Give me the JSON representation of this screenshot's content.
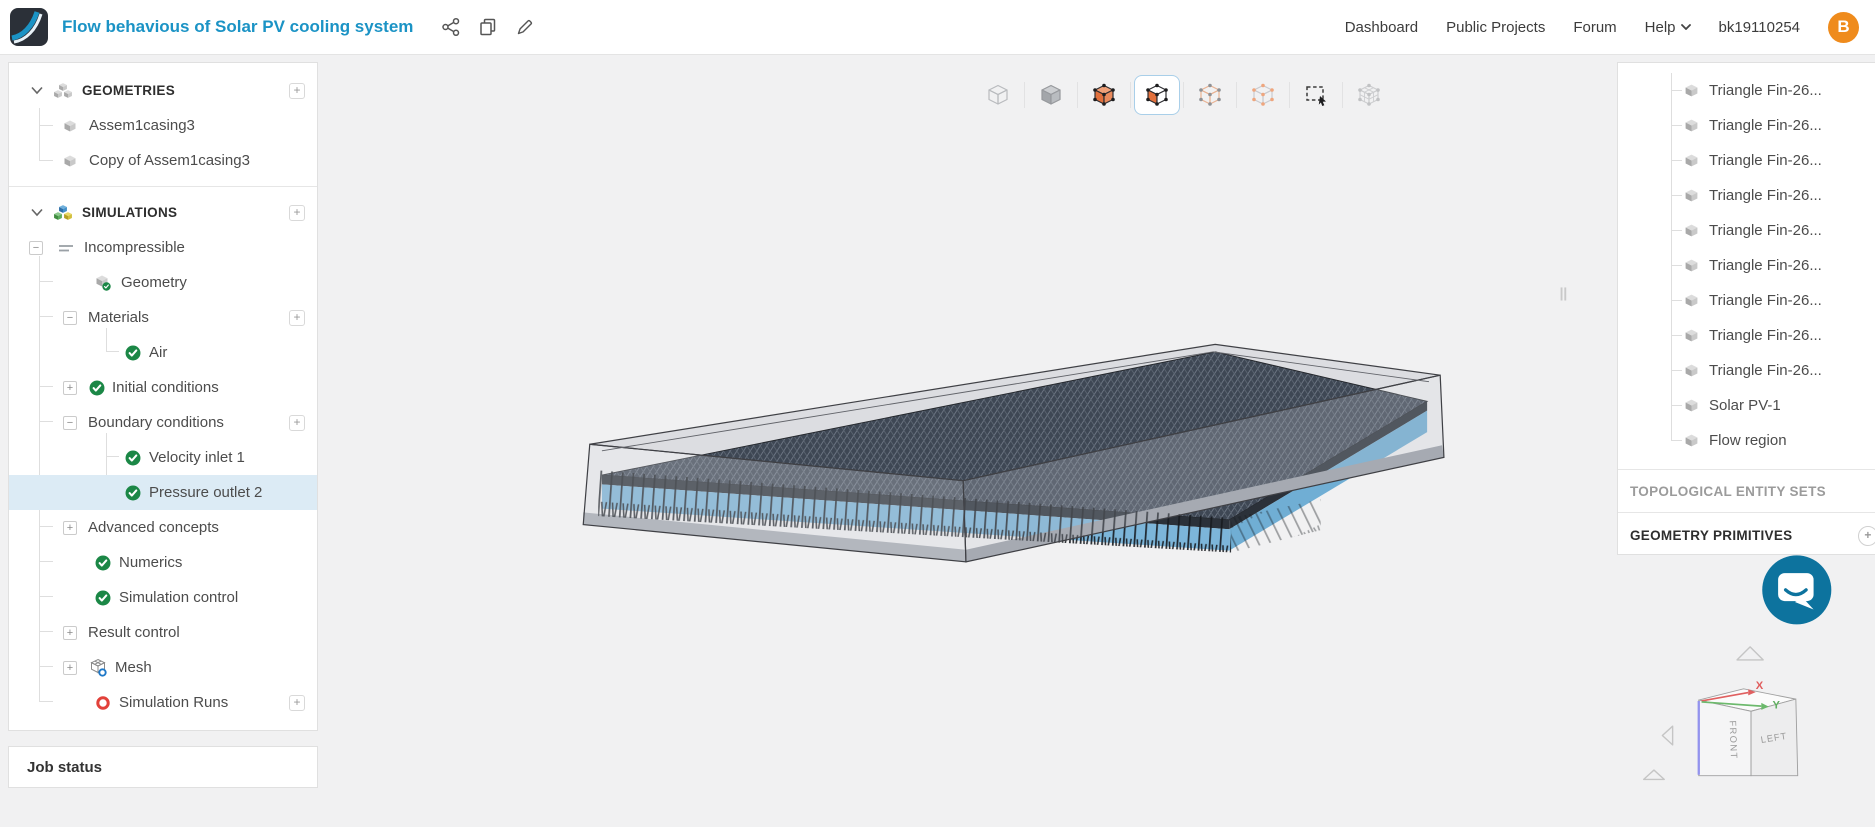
{
  "header": {
    "title": "Flow behavious of Solar PV cooling system",
    "nav": [
      "Dashboard",
      "Public Projects",
      "Forum"
    ],
    "help_label": "Help",
    "username": "bk19110254",
    "avatar_initial": "B",
    "title_icons": [
      "share-icon",
      "duplicate-icon",
      "edit-icon"
    ]
  },
  "sidebar": {
    "geometries": {
      "header": "GEOMETRIES",
      "items": [
        "Assem1casing3",
        "Copy of Assem1casing3"
      ]
    },
    "simulations": {
      "header": "SIMULATIONS",
      "labels": {
        "incompressible": "Incompressible",
        "geometry": "Geometry",
        "materials": "Materials",
        "air": "Air",
        "initial": "Initial conditions",
        "boundary": "Boundary conditions",
        "velocity": "Velocity inlet 1",
        "pressure": "Pressure outlet 2",
        "advanced": "Advanced concepts",
        "numerics": "Numerics",
        "simcontrol": "Simulation control",
        "result": "Result control",
        "mesh": "Mesh",
        "runs": "Simulation Runs"
      }
    },
    "job_status": "Job status"
  },
  "toolbar": {
    "icons": [
      "isometric-view-icon",
      "solid-view-icon",
      "select-volume-icon",
      "select-face-icon",
      "select-edge-icon",
      "select-vertex-icon",
      "box-select-icon",
      "mesh-view-icon"
    ],
    "active_index": 3
  },
  "right_panel": {
    "items": [
      "Triangle Fin-26...",
      "Triangle Fin-26...",
      "Triangle Fin-26...",
      "Triangle Fin-26...",
      "Triangle Fin-26...",
      "Triangle Fin-26...",
      "Triangle Fin-26...",
      "Triangle Fin-26...",
      "Triangle Fin-26...",
      "Solar PV-1",
      "Flow region"
    ],
    "topological_header": "TOPOLOGICAL ENTITY SETS",
    "primitives_header": "GEOMETRY PRIMITIVES"
  },
  "viewport": {
    "nav_cube": {
      "front": "FRONT",
      "left": "LEFT",
      "axis_x": "X",
      "axis_y": "Y"
    }
  },
  "glyphs": {
    "plus": "+",
    "minus": "−"
  },
  "colors": {
    "accent": "#1b93c5",
    "selected_row": "#dcebf5",
    "green": "#1b8746",
    "red": "#e2413a",
    "avatar_orange": "#ef8b1c",
    "chat_blue": "#0d739e",
    "select_orange": "#e2703c",
    "flow_blue": "#7cb5d9",
    "panel_dark": "#3e4754"
  }
}
